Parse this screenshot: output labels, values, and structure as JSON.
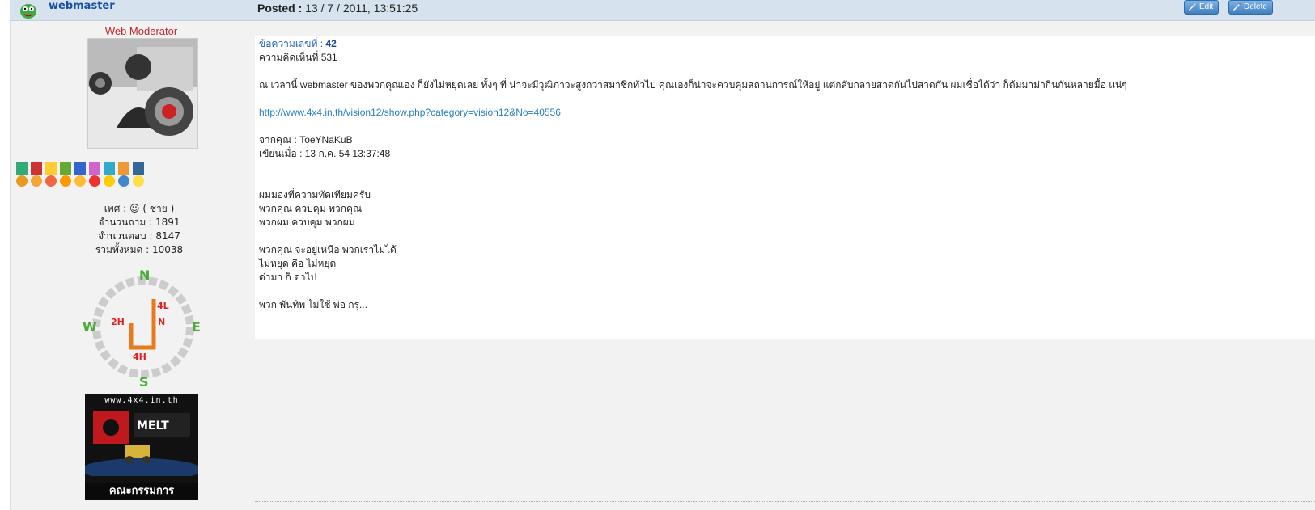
{
  "header": {
    "username": "webmaster",
    "posted_label": "Posted :",
    "posted_value": "13 / 7 / 2011, 13:51:25",
    "edit_label": "Edit",
    "delete_label": "Delete"
  },
  "profile": {
    "role": "Web Moderator",
    "stats": [
      "เพศ :",
      "( ชาย )",
      "จำนวนถาม : 1891",
      "จำนวนตอบ : 8147",
      "รวมทั้งหมด : 10038"
    ],
    "badge_site": "www.4x4.in.th",
    "badge_title": "คณะกรรมการ"
  },
  "post": {
    "message_no_label": "ข้อความเลขที่ :",
    "message_no": "42",
    "comment_no": "ความคิดเห็นที่ 531",
    "body1": "ณ เวลานี้ webmaster ของพวกคุณเอง ก็ยังไม่หยุดเลย ทั้งๆ ที่ น่าจะมีวุฒิภาวะสูงกว่าสมาชิกทั่วไป คุณเองก็น่าจะควบคุมสถานการณ์ให้อยู่ แต่กลับกลายสาดกันไปสาดกัน ผมเชื่อได้ว่า ก็ต้มมาม่ากินกันหลายมื้อ แน่ๆ",
    "link": "http://www.4x4.in.th/vision12/show.php?category=vision12&No=40556",
    "from": "จากคุณ : ToeYNaKuB",
    "written": "เขียนเมื่อ : 13 ก.ค. 54 13:37:48",
    "lines": [
      "ผมมองที่ความทัดเทียมครับ",
      "พวกคุณ ควบคุม พวกคุณ",
      "พวกผม ควบคุม พวกผม",
      "",
      "พวกคุณ จะอยู่เหนือ พวกเราไม่ได้",
      "ไม่หยุด คือ ไม่หยุด",
      "ด่ามา ก็ ด่าไป",
      "",
      "พวก พันทิพ ไม่ใช้ พ่อ กรุ..."
    ]
  }
}
